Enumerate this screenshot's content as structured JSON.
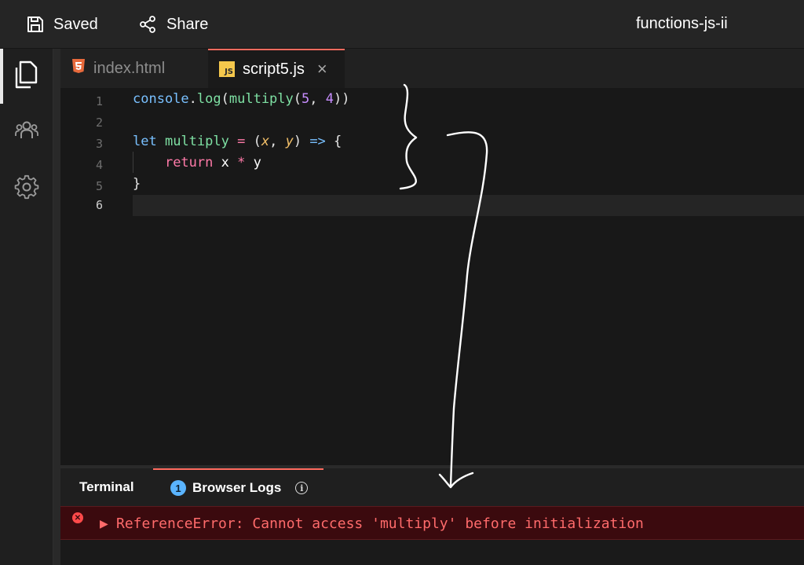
{
  "topbar": {
    "saved_label": "Saved",
    "share_label": "Share",
    "project_title": "functions-js-ii"
  },
  "sidebar": {
    "items": [
      {
        "icon": "files-icon",
        "active": true
      },
      {
        "icon": "collaborators-icon",
        "active": false
      },
      {
        "icon": "gear-icon",
        "active": false
      }
    ]
  },
  "tabs": [
    {
      "label": "index.html",
      "icon": "html5-icon",
      "active": false
    },
    {
      "label": "script5.js",
      "icon": "js-icon",
      "icon_text": "JS",
      "active": true,
      "close_glyph": "×"
    }
  ],
  "editor": {
    "line_numbers": [
      "1",
      "2",
      "3",
      "4",
      "5",
      "6"
    ],
    "current_line": 6,
    "lines": [
      [
        [
          "console",
          "t-obj"
        ],
        [
          ".",
          "t-pun"
        ],
        [
          "log",
          "t-fn"
        ],
        [
          "(",
          "t-pun"
        ],
        [
          "multiply",
          "t-fn"
        ],
        [
          "(",
          "t-pun"
        ],
        [
          "5",
          "t-num"
        ],
        [
          ", ",
          "t-pun"
        ],
        [
          "4",
          "t-num"
        ],
        [
          "))",
          "t-pun"
        ]
      ],
      [],
      [
        [
          "let",
          "t-kw"
        ],
        [
          " ",
          "t-pun"
        ],
        [
          "multiply",
          "t-var"
        ],
        [
          " ",
          "t-pun"
        ],
        [
          "=",
          "t-op"
        ],
        [
          " (",
          "t-pun"
        ],
        [
          "x",
          "t-par"
        ],
        [
          ", ",
          "t-pun"
        ],
        [
          "y",
          "t-par"
        ],
        [
          ") ",
          "t-pun"
        ],
        [
          "=>",
          "t-arrow"
        ],
        [
          " {",
          "t-pun"
        ]
      ],
      [
        [
          "    ",
          "t-pun"
        ],
        [
          "return",
          "t-ret"
        ],
        [
          " x ",
          "t-id"
        ],
        [
          "*",
          "t-op"
        ],
        [
          " y",
          "t-id"
        ]
      ],
      [
        [
          "}",
          "t-pun"
        ]
      ],
      []
    ]
  },
  "panel": {
    "tabs": [
      {
        "label": "Terminal",
        "active": false
      },
      {
        "label": "Browser Logs",
        "active": true,
        "badge_count": "1"
      }
    ],
    "info_glyph": "i",
    "logs": [
      {
        "level": "error",
        "toggle": "▶",
        "message": "ReferenceError: Cannot access 'multiply' before initialization"
      }
    ]
  },
  "colors": {
    "accent": "#ff6b5e",
    "error_text": "#ff6b6b",
    "error_bg": "#3b0a0e",
    "annotation_ink": "#ffffff"
  }
}
